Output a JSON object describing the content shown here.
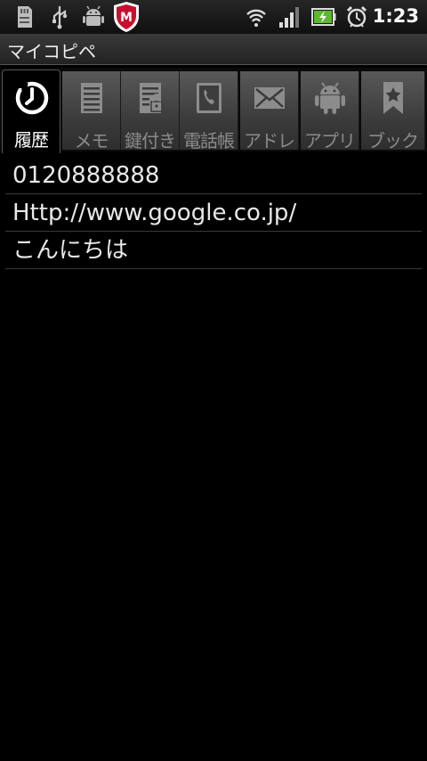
{
  "status_bar": {
    "time": "1:23",
    "left_icons": [
      "sd-card-icon",
      "usb-icon",
      "android-debug-icon",
      "mcafee-shield-icon"
    ],
    "right_icons": [
      "wifi-icon",
      "signal-icon",
      "battery-charging-icon",
      "alarm-clock-icon"
    ]
  },
  "app": {
    "title": "マイコピペ"
  },
  "tabs": [
    {
      "label": "履歴",
      "icon": "history-clock-icon",
      "active": true
    },
    {
      "label": "メモ",
      "icon": "memo-icon",
      "active": false
    },
    {
      "label": "鍵付き",
      "icon": "locked-memo-icon",
      "active": false
    },
    {
      "label": "電話帳",
      "icon": "phone-book-icon",
      "active": false
    },
    {
      "label": "アドレ",
      "icon": "mail-envelope-icon",
      "active": false
    },
    {
      "label": "アプリ",
      "icon": "android-app-icon",
      "active": false
    },
    {
      "label": "ブック",
      "icon": "bookmark-icon",
      "active": false
    }
  ],
  "history": [
    {
      "text": "0120888888"
    },
    {
      "text": "Http://www.google.co.jp/"
    },
    {
      "text": "こんにちは"
    }
  ]
}
